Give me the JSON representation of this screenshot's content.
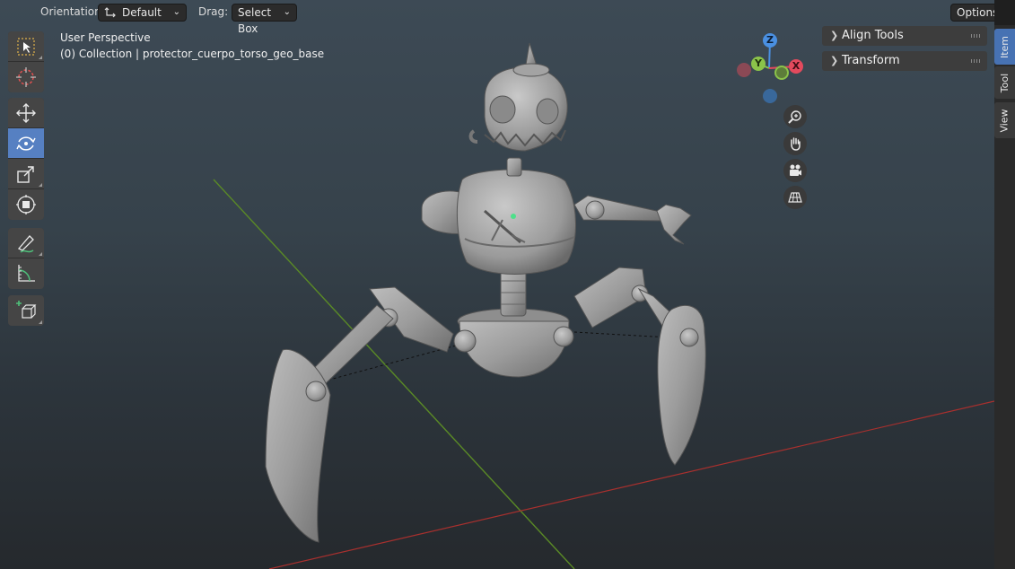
{
  "header": {
    "orientation_label": "Orientation:",
    "orientation_value": "Default",
    "drag_label": "Drag:",
    "drag_value": "Select Box",
    "options_label": "Options"
  },
  "viewport": {
    "perspective": "User Perspective",
    "collection": "(0) Collection | protector_cuerpo_torso_geo_base"
  },
  "toolbar": {
    "tools": [
      {
        "name": "select-box",
        "icon": "select-box-icon"
      },
      {
        "name": "cursor",
        "icon": "cursor-icon"
      },
      {
        "name": "move",
        "icon": "move-icon"
      },
      {
        "name": "rotate",
        "icon": "rotate-icon",
        "active": true
      },
      {
        "name": "scale",
        "icon": "scale-icon"
      },
      {
        "name": "transform",
        "icon": "transform-icon"
      },
      {
        "name": "annotate",
        "icon": "annotate-icon"
      },
      {
        "name": "measure",
        "icon": "measure-icon"
      },
      {
        "name": "add-cube",
        "icon": "add-cube-icon"
      }
    ]
  },
  "gizmo": {
    "z": "Z",
    "y": "Y",
    "x": "X",
    "colors": {
      "x": "#e34a5d",
      "y": "#8bc34a",
      "z": "#4a90e2"
    }
  },
  "nav_buttons": [
    "zoom-icon",
    "hand-pan-icon",
    "camera-icon",
    "grid-ortho-icon"
  ],
  "panels": {
    "align_tools": "Align Tools",
    "transform": "Transform"
  },
  "sidebar_tabs": {
    "item": "Item",
    "tool": "Tool",
    "view": "View"
  },
  "colors": {
    "accent": "#5680c2",
    "x_axis_line": "#b0302f",
    "y_axis_line": "#5a8a26"
  }
}
